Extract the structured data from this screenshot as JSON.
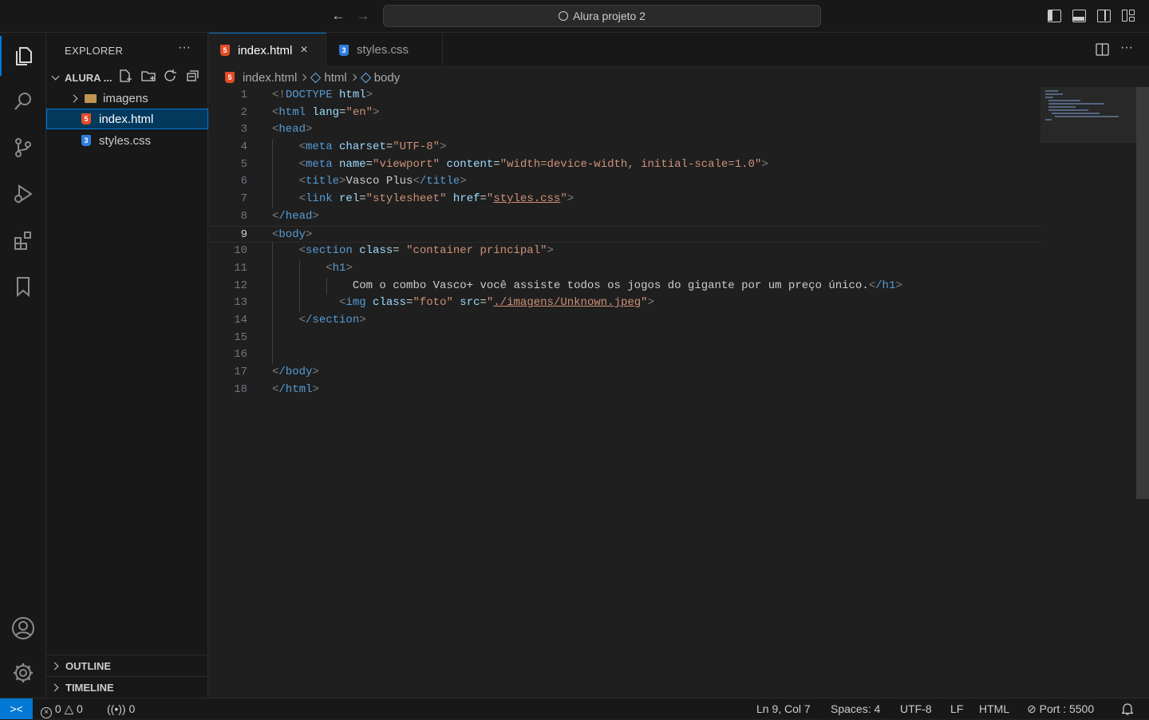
{
  "titlebar": {
    "back_icon": "←",
    "forward_icon": "→",
    "search_label": "Alura projeto 2"
  },
  "activity_bar": {
    "items": [
      "explorer-icon",
      "search-icon",
      "source-control-icon",
      "run-debug-icon",
      "extensions-icon",
      "bookmarks-icon"
    ],
    "bottom": [
      "account-icon",
      "settings-gear-icon"
    ]
  },
  "sidebar": {
    "title": "EXPLORER",
    "more_label": "···",
    "folder_name": "ALURA ...",
    "tree": [
      {
        "name": "imagens",
        "type": "folder"
      },
      {
        "name": "index.html",
        "type": "html"
      },
      {
        "name": "styles.css",
        "type": "css"
      }
    ],
    "outline_label": "OUTLINE",
    "timeline_label": "TIMELINE"
  },
  "tabs": [
    {
      "label": "index.html",
      "type": "html",
      "active": true,
      "close": "×"
    },
    {
      "label": "styles.css",
      "type": "css",
      "active": false
    }
  ],
  "breadcrumb": {
    "file": "index.html",
    "html": "html",
    "body": "body"
  },
  "editor": {
    "current_line": 9,
    "line_numbers": [
      "1",
      "2",
      "3",
      "4",
      "5",
      "6",
      "7",
      "8",
      "9",
      "10",
      "11",
      "12",
      "13",
      "14",
      "15",
      "16",
      "17",
      "18"
    ],
    "code": {
      "l1_open": "<!",
      "l1_doctype": "DOCTYPE",
      "l1_html": "html",
      "l1_close": ">",
      "l2_tag": "html",
      "l2_attr": "lang",
      "l2_val": "\"en\"",
      "l3_tag": "head",
      "l4_tag": "meta",
      "l4_attr": "charset",
      "l4_val": "\"UTF-8\"",
      "l5_tag": "meta",
      "l5_attr1": "name",
      "l5_val1": "\"viewport\"",
      "l5_attr2": "content",
      "l5_val2": "\"width=device-width, initial-scale=1.0\"",
      "l6_tag": "title",
      "l6_text": "Vasco Plus",
      "l6_end": "/title",
      "l7_tag": "link",
      "l7_attr1": "rel",
      "l7_val1": "\"stylesheet\"",
      "l7_attr2": "href",
      "l7_val2": "styles.css",
      "l8_tag": "/head",
      "l9_tag": "body",
      "l10_tag": "section",
      "l10_attr": "class",
      "l10_val": "\"container principal\"",
      "l11_tag": "h1",
      "l12_text": "Com o combo Vasco+ você assiste todos os jogos do gigante por um preço único.",
      "l12_end": "/h1",
      "l13_tag": "img",
      "l13_attr1": "class",
      "l13_val1": "\"foto\"",
      "l13_attr2": "src",
      "l13_val2": "./imagens/Unknown.jpeg",
      "l14_tag": "/section",
      "l17_tag": "/body",
      "l18_tag": "/html"
    }
  },
  "statusbar": {
    "errors": "0",
    "warnings": "0",
    "ports": "0",
    "position": "Ln 9, Col 7",
    "spaces": "Spaces: 4",
    "encoding": "UTF-8",
    "eol": "LF",
    "language": "HTML",
    "port": "Port : 5500"
  },
  "colors": {
    "accent": "#0078d4",
    "tag": "#569cd6",
    "attr": "#9cdcfe",
    "string": "#ce9178",
    "html_icon": "#e44d26",
    "css_icon": "#2e7de0"
  }
}
